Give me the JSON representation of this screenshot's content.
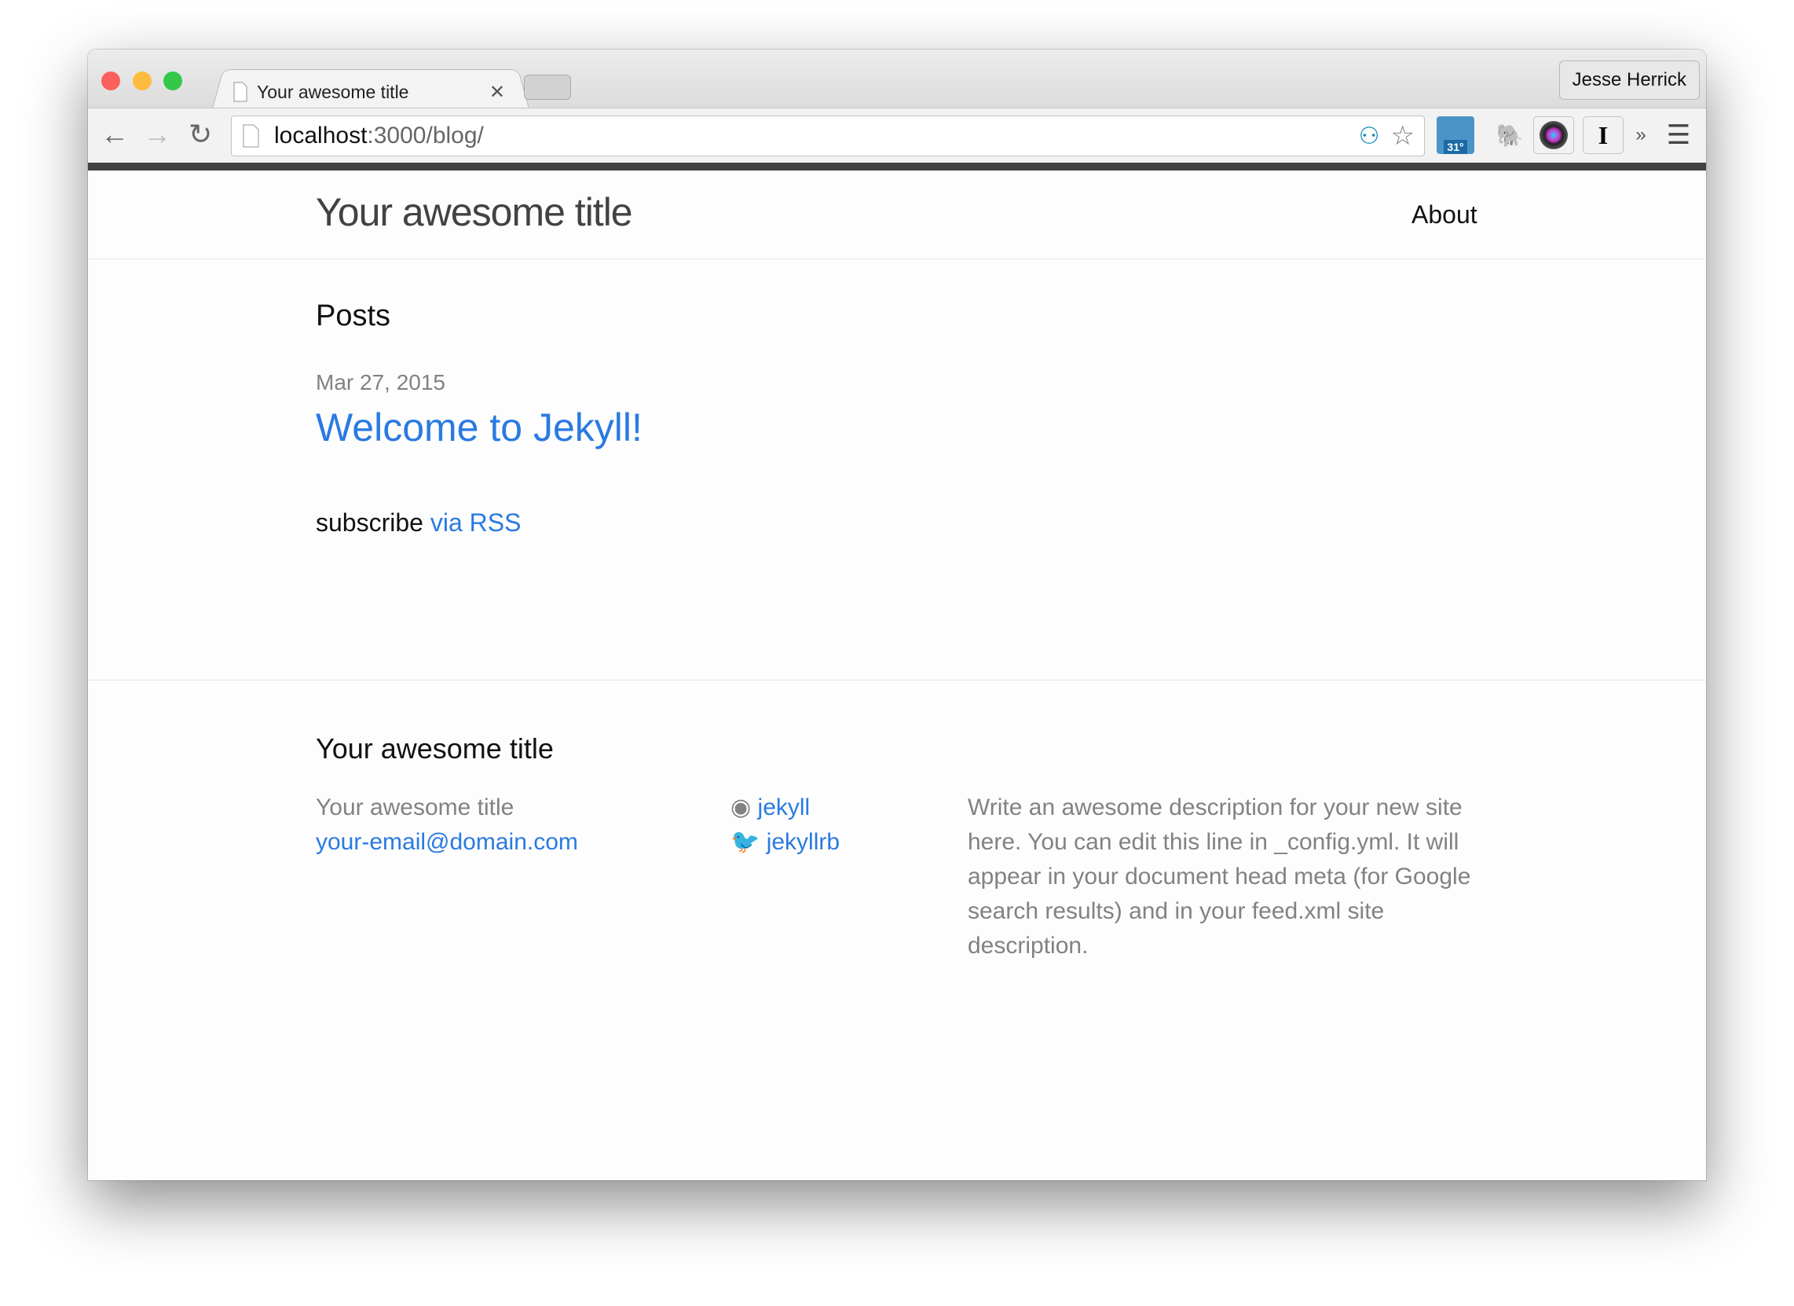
{
  "browser": {
    "tab_title": "Your awesome title",
    "profile_name": "Jesse Herrick",
    "url_host": "localhost",
    "url_rest": ":3000/blog/",
    "weather_badge": "31°",
    "extensions": [
      "network-icon",
      "star-icon",
      "weather-icon",
      "evernote-icon",
      "camera-icon",
      "instapaper-icon",
      "overflow-icon",
      "menu-icon"
    ]
  },
  "header": {
    "title": "Your awesome title",
    "nav": [
      {
        "label": "About"
      }
    ]
  },
  "main": {
    "heading": "Posts",
    "posts": [
      {
        "date": "Mar 27, 2015",
        "title": "Welcome to Jekyll!"
      }
    ],
    "subscribe_text": "subscribe",
    "subscribe_link": "via RSS"
  },
  "footer": {
    "heading": "Your awesome title",
    "name": "Your awesome title",
    "email": "your-email@domain.com",
    "github": "jekyll",
    "twitter": "jekyllrb",
    "description": "Write an awesome description for your new site here. You can edit this line in _config.yml. It will appear in your document head meta (for Google search results) and in your feed.xml site description."
  },
  "colors": {
    "link": "#2a7ae2",
    "text": "#111111",
    "muted": "#828282"
  }
}
